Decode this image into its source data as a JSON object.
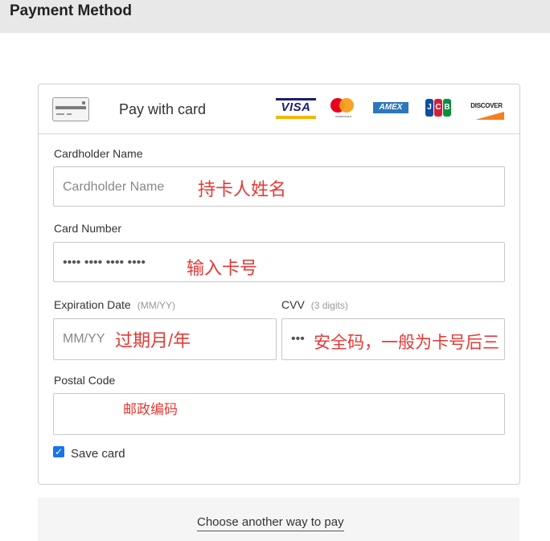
{
  "header": {
    "title": "Payment Method"
  },
  "card_panel": {
    "pay_with_label": "Pay with card",
    "brands": {
      "visa": "VISA",
      "mastercard": "mastercard",
      "amex": "AMEX",
      "jcb": [
        "J",
        "C",
        "B"
      ],
      "discover": "DISCOVER"
    }
  },
  "form": {
    "cardholder": {
      "label": "Cardholder Name",
      "placeholder": "Cardholder Name",
      "annotation": "持卡人姓名"
    },
    "card_number": {
      "label": "Card Number",
      "placeholder": "•••• •••• •••• ••••",
      "annotation": "输入卡号"
    },
    "expiration": {
      "label": "Expiration Date",
      "hint": "(MM/YY)",
      "placeholder": "MM/YY",
      "annotation": "过期月/年"
    },
    "cvv": {
      "label": "CVV",
      "hint": "(3 digits)",
      "placeholder": "•••",
      "annotation": "安全码，一般为卡号后三"
    },
    "postal": {
      "label": "Postal Code",
      "annotation": "邮政编码"
    },
    "save_card": {
      "label": "Save card",
      "checked": true
    }
  },
  "footer": {
    "alt_pay_label": "Choose another way to pay"
  },
  "colors": {
    "annotation": "#e53935",
    "checkbox": "#1a73e8",
    "header_bg": "#e8e8e8"
  }
}
